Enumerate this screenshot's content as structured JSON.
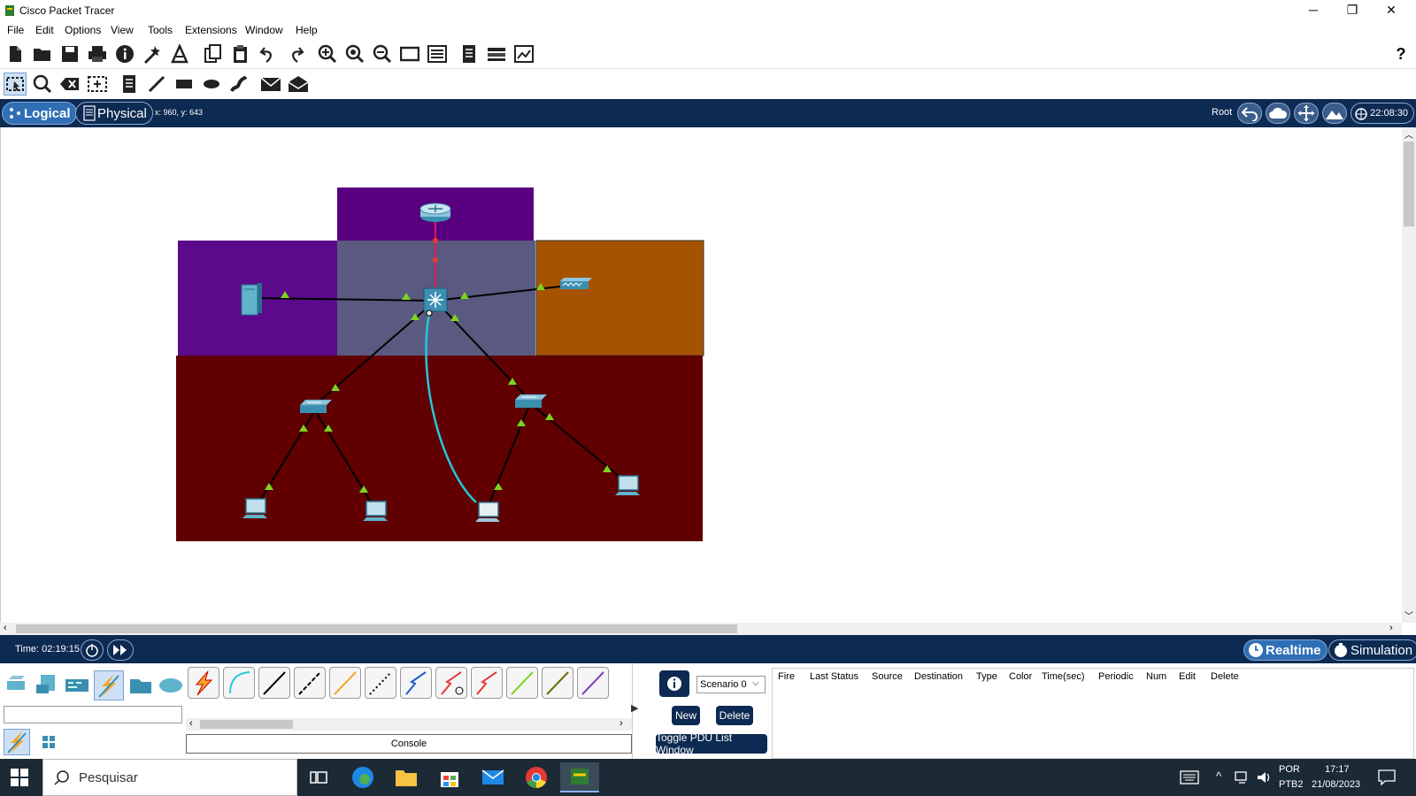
{
  "window": {
    "title": "Cisco Packet Tracer",
    "minimize": "─",
    "maximize": "❐",
    "close": "✕"
  },
  "menu": [
    "File",
    "Edit",
    "Options",
    "View",
    "Tools",
    "Extensions",
    "Window",
    "Help"
  ],
  "toolbar1": {
    "icons": [
      "new-file-icon",
      "open-folder-icon",
      "save-icon",
      "print-icon",
      "info-icon",
      "wizard-icon",
      "activity-wizard-icon",
      "copy-icon",
      "paste-icon",
      "undo-icon",
      "redo-icon",
      "zoom-in-icon",
      "zoom-reset-icon",
      "zoom-out-icon",
      "drawing-palette-icon",
      "custom-device-icon",
      "view-commands-icon",
      "cluster-icon",
      "ipc-icon"
    ],
    "help": "?"
  },
  "toolbar2": {
    "icons": [
      "select-icon",
      "inspect-icon",
      "delete-icon",
      "resize-icon",
      "note-icon",
      "line-icon",
      "rectangle-icon",
      "ellipse-icon",
      "freeform-icon",
      "simple-pdu-icon",
      "complex-pdu-icon"
    ]
  },
  "navbar": {
    "logical": "Logical",
    "physical": "Physical",
    "coords": "x: 960, y: 643",
    "root": "Root",
    "clock": "22:08:30",
    "icons": [
      "back-icon",
      "cloud-icon",
      "move-icon",
      "landscape-icon",
      "viewport-icon"
    ]
  },
  "topology": {
    "zones": [
      {
        "name": "zone-router",
        "color": "#580080"
      },
      {
        "name": "zone-server",
        "color": "#5a0a8a"
      },
      {
        "name": "zone-core",
        "color": "#5a5a80"
      },
      {
        "name": "zone-wireless",
        "color": "#a65300"
      },
      {
        "name": "zone-lan",
        "color": "#600000"
      }
    ],
    "devices": [
      "router",
      "multilayer-switch",
      "server",
      "access-point",
      "switch-left",
      "switch-right",
      "pc-1",
      "pc-2",
      "pc-3",
      "pc-4"
    ]
  },
  "timebar": {
    "time": "Time: 02:19:15",
    "realtime": "Realtime",
    "simulation": "Simulation"
  },
  "devices_panel": {
    "categories": [
      "network-devices-icon",
      "end-devices-icon",
      "components-icon",
      "connections-icon",
      "misc-icon",
      "multiuser-icon"
    ],
    "search_value": ""
  },
  "connections": {
    "types": [
      "auto-connection-icon",
      "console-cable-icon",
      "straight-through-icon",
      "crossover-icon",
      "fiber-icon",
      "phone-icon",
      "coaxial-icon",
      "serial-dce-icon",
      "serial-dte-icon",
      "octal-icon",
      "iot-custom-icon",
      "usb-icon"
    ],
    "selected_label": "Console"
  },
  "pdu": {
    "scenario": "Scenario 0",
    "new": "New",
    "delete": "Delete",
    "toggle": "Toggle PDU List Window",
    "columns": [
      "Fire",
      "Last Status",
      "Source",
      "Destination",
      "Type",
      "Color",
      "Time(sec)",
      "Periodic",
      "Num",
      "Edit",
      "Delete"
    ]
  },
  "taskbar": {
    "search_placeholder": "Pesquisar",
    "lang1": "POR",
    "lang2": "PTB2",
    "time": "17:17",
    "date": "21/08/2023"
  }
}
